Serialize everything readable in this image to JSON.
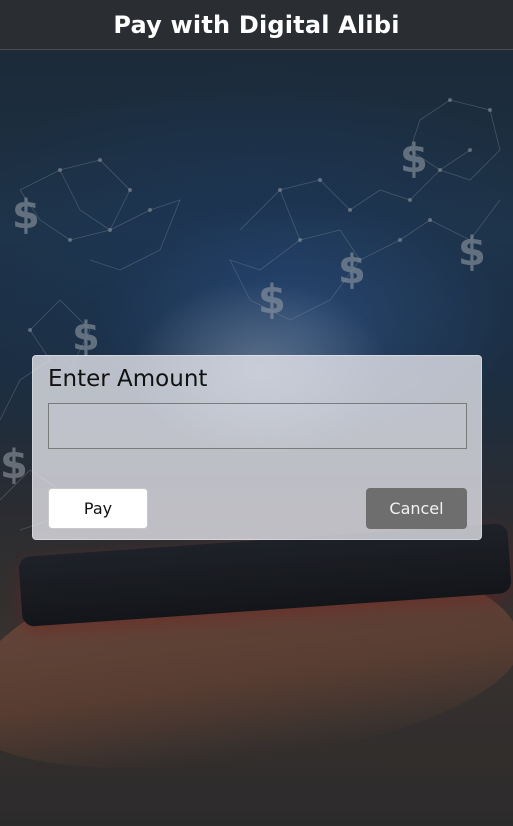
{
  "header": {
    "title": "Pay with Digital Alibi"
  },
  "dialog": {
    "title": "Enter Amount",
    "amount_value": "",
    "amount_placeholder": "",
    "pay_label": "Pay",
    "cancel_label": "Cancel"
  },
  "background": {
    "icons": [
      "dollar-sign-icon",
      "network-mesh",
      "hand-holding-phone"
    ],
    "dollar_glyph": "$"
  },
  "colors": {
    "header_bg": "#2a2d31",
    "pay_button_bg": "#ffffff",
    "cancel_button_bg": "#6e6e6e",
    "dialog_bg": "#e8e8ee"
  }
}
